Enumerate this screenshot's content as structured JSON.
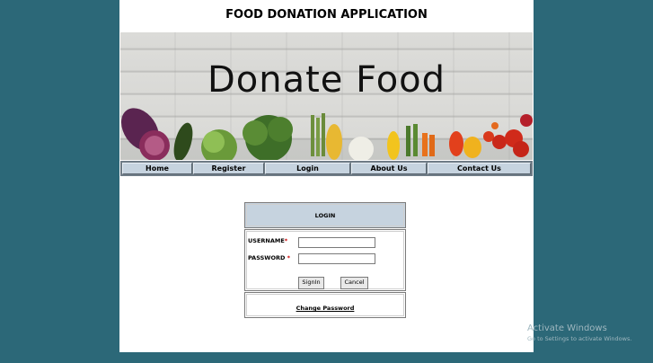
{
  "app": {
    "title": "FOOD DONATION APPLICATION"
  },
  "banner": {
    "text": "Donate Food"
  },
  "nav": {
    "items": [
      {
        "label": "Home"
      },
      {
        "label": "Register"
      },
      {
        "label": "Login"
      },
      {
        "label": "About Us"
      },
      {
        "label": "Contact Us"
      }
    ]
  },
  "login": {
    "header": "LOGIN",
    "username_label": "USERNAME",
    "password_label": "PASSWORD ",
    "required_mark": "*",
    "username_value": "",
    "password_value": "",
    "signin_label": "SignIn",
    "cancel_label": "Cancel",
    "change_password_label": "Change Password"
  },
  "watermark": {
    "title": "Activate Windows",
    "subtitle": "Go to Settings to activate Windows."
  },
  "colors": {
    "background": "#2c6878",
    "nav_button": "#c6d3df",
    "login_header": "#c6d3df",
    "required": "#cc0000"
  }
}
